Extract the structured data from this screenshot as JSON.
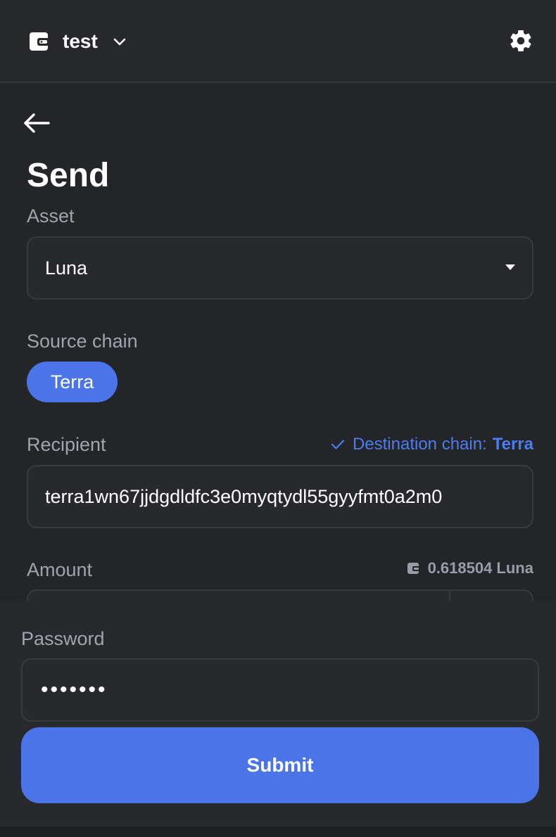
{
  "header": {
    "wallet_name": "test",
    "wallet_icon": "wallet-icon",
    "switch_icon": "chevron-down-icon",
    "settings_icon": "gear-icon"
  },
  "nav": {
    "back_icon": "arrow-left-icon"
  },
  "page": {
    "title": "Send"
  },
  "asset": {
    "label": "Asset",
    "selected": "Luna"
  },
  "source_chain": {
    "label": "Source chain",
    "selected": "Terra"
  },
  "recipient": {
    "label": "Recipient",
    "destination_prefix": "Destination chain:",
    "destination_chain": "Terra",
    "value": "terra1wn67jjdgdldfc3e0myqtydl55gyyfmt0a2m0"
  },
  "amount": {
    "label": "Amount",
    "balance": "0.618504 Luna"
  },
  "password": {
    "label": "Password",
    "value": "•••••••"
  },
  "submit": {
    "label": "Submit"
  },
  "colors": {
    "accent": "#4a74e8",
    "background": "#242529",
    "muted_text": "#a2a4ab"
  }
}
